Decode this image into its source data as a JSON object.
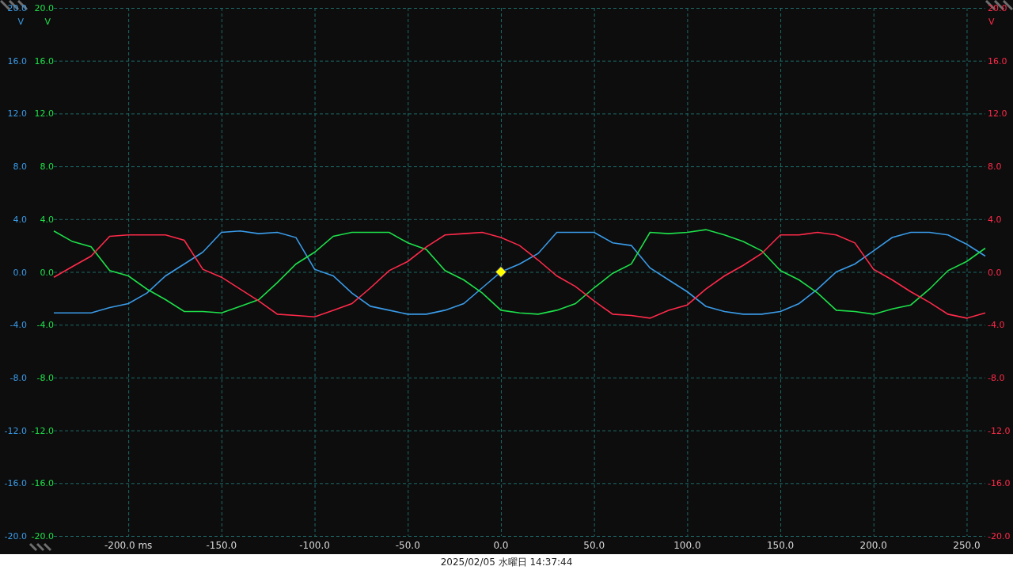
{
  "scope": {
    "chart_data": {
      "type": "line",
      "x": [
        -240,
        -230,
        -220,
        -210,
        -200,
        -190,
        -180,
        -170,
        -160,
        -150,
        -140,
        -130,
        -120,
        -110,
        -100,
        -90,
        -80,
        -70,
        -60,
        -50,
        -40,
        -30,
        -20,
        -10,
        0,
        10,
        20,
        30,
        40,
        50,
        60,
        70,
        80,
        90,
        100,
        110,
        120,
        130,
        140,
        150,
        160,
        170,
        180,
        190,
        200,
        210,
        220,
        230,
        240,
        250,
        260
      ],
      "series": [
        {
          "color": "#3a9be8",
          "values": [
            -3.1,
            -3.1,
            -3.1,
            -2.7,
            -2.4,
            -1.6,
            -0.3,
            0.6,
            1.5,
            3.0,
            3.1,
            2.9,
            3.0,
            2.6,
            0.2,
            -0.3,
            -1.6,
            -2.6,
            -2.9,
            -3.2,
            -3.2,
            -2.9,
            -2.4,
            -1.2,
            0.0,
            0.6,
            1.4,
            3.0,
            3.0,
            3.0,
            2.2,
            2.0,
            0.3,
            -0.6,
            -1.5,
            -2.6,
            -3.0,
            -3.2,
            -3.2,
            -3.0,
            -2.4,
            -1.3,
            0.0,
            0.6,
            1.6,
            2.6,
            3.0,
            3.0,
            2.8,
            2.1,
            1.2
          ]
        },
        {
          "color": "#1ee04a",
          "values": [
            3.1,
            2.3,
            1.9,
            0.1,
            -0.3,
            -1.3,
            -2.1,
            -3.0,
            -3.0,
            -3.1,
            -2.6,
            -2.1,
            -0.8,
            0.6,
            1.5,
            2.7,
            3.0,
            3.0,
            3.0,
            2.2,
            1.7,
            0.1,
            -0.6,
            -1.6,
            -2.9,
            -3.1,
            -3.2,
            -2.9,
            -2.4,
            -1.2,
            -0.1,
            0.6,
            3.0,
            2.9,
            3.0,
            3.2,
            2.8,
            2.3,
            1.6,
            0.1,
            -0.6,
            -1.6,
            -2.9,
            -3.0,
            -3.2,
            -2.8,
            -2.5,
            -1.3,
            0.1,
            0.8,
            1.8
          ]
        },
        {
          "color": "#ff2a4a",
          "values": [
            -0.4,
            0.4,
            1.2,
            2.7,
            2.8,
            2.8,
            2.8,
            2.4,
            0.2,
            -0.4,
            -1.3,
            -2.2,
            -3.2,
            -3.3,
            -3.4,
            -2.9,
            -2.4,
            -1.2,
            0.1,
            0.8,
            1.9,
            2.8,
            2.9,
            3.0,
            2.6,
            2.0,
            0.9,
            -0.3,
            -1.1,
            -2.2,
            -3.2,
            -3.3,
            -3.5,
            -2.9,
            -2.5,
            -1.3,
            -0.3,
            0.5,
            1.4,
            2.8,
            2.8,
            3.0,
            2.8,
            2.2,
            0.2,
            -0.6,
            -1.5,
            -2.3,
            -3.2,
            -3.5,
            -3.1
          ]
        }
      ],
      "xlim": [
        -240,
        260
      ],
      "ylim": [
        -20,
        20
      ],
      "xticks": [
        {
          "value": -200,
          "label": "-200.0 ms"
        },
        {
          "value": -150,
          "label": "-150.0"
        },
        {
          "value": -100,
          "label": "-100.0"
        },
        {
          "value": -50,
          "label": "-50.0"
        },
        {
          "value": 0,
          "label": "0.0"
        },
        {
          "value": 50,
          "label": "50.0"
        },
        {
          "value": 100,
          "label": "100.0"
        },
        {
          "value": 150,
          "label": "150.0"
        },
        {
          "value": 200,
          "label": "200.0"
        },
        {
          "value": 250,
          "label": "250.0"
        }
      ],
      "yticks": [
        {
          "value": 20,
          "label": "20.0"
        },
        {
          "value": 16,
          "label": "16.0"
        },
        {
          "value": 12,
          "label": "12.0"
        },
        {
          "value": 8,
          "label": "8.0"
        },
        {
          "value": 4,
          "label": "4.0"
        },
        {
          "value": 0,
          "label": "0.0"
        },
        {
          "value": -4,
          "label": "-4.0"
        },
        {
          "value": -8,
          "label": "-8.0"
        },
        {
          "value": -12,
          "label": "-12.0"
        },
        {
          "value": -16,
          "label": "-16.0"
        },
        {
          "value": -20,
          "label": "-20.0"
        }
      ],
      "grid": true
    },
    "y_axes": [
      {
        "color": "#3a9be8",
        "unit": "V",
        "labels": [
          "20.0",
          "16.0",
          "12.0",
          "8.0",
          "4.0",
          "0.0",
          "-4.0",
          "-8.0",
          "-12.0",
          "-16.0",
          "-20.0"
        ]
      },
      {
        "color": "#1ee04a",
        "unit": "V"
      },
      {
        "color": "#ff2a4a",
        "unit": "V",
        "labels": [
          "20.0",
          "16.0",
          "12.0",
          "8.0",
          "4.0",
          "0.0",
          "-4.0",
          "-8.0",
          "-12.0",
          "-16.0",
          "-20.0"
        ]
      }
    ]
  },
  "status_bar": {
    "timestamp": "2025/02/05 水曜日 14:37:44"
  }
}
